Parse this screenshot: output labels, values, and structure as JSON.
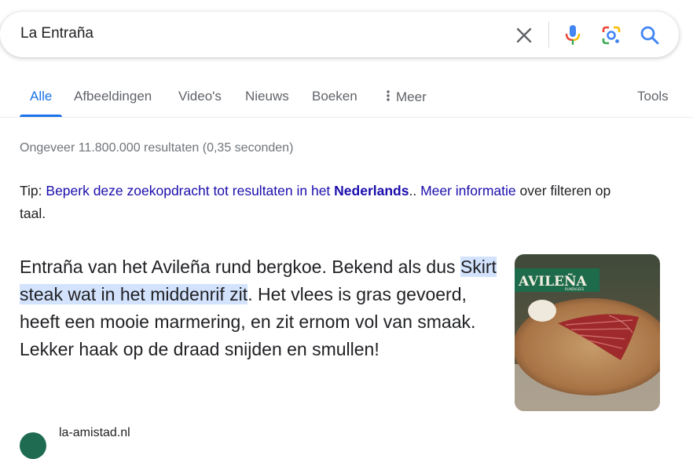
{
  "search": {
    "query": "La Entraña"
  },
  "icons": {
    "clear": "close-icon",
    "voice": "mic-icon",
    "lens": "camera-lens-icon",
    "search": "search-icon",
    "more": "vertical-dots-icon"
  },
  "tabs": [
    {
      "label": "Alle",
      "active": true
    },
    {
      "label": "Afbeeldingen"
    },
    {
      "label": "Video's"
    },
    {
      "label": "Nieuws"
    },
    {
      "label": "Boeken"
    },
    {
      "label": "Meer"
    },
    {
      "label": "Tools"
    }
  ],
  "result_stats": "Ongeveer 11.800.000 resultaten (0,35 seconden)",
  "tip": {
    "prefix": "Tip: ",
    "link_text": "Beperk deze zoekopdracht tot resultaten in het ",
    "link_bold": "Nederlands",
    "after_link": ".. ",
    "more_link": "Meer informatie",
    "suffix": " over filteren op taal."
  },
  "snippet": {
    "before": "Entraña van het Avileña rund bergkoe. Bekend als dus ",
    "highlight": "Skirt steak wat in het middenrif zit",
    "after": ". Het vlees is gras gevoerd, heeft een mooie marmering, en zit ernom vol van smaak. Lekker haak op de draad snijden en smullen!"
  },
  "thumbnail": {
    "brand": "AVILEÑA",
    "subtitle": "RUNDVLEES"
  },
  "source": {
    "name": "la-amistad.nl"
  },
  "colors": {
    "link": "#1a0dab",
    "accent": "#1a73e8",
    "highlight": "#d3e3fd"
  }
}
